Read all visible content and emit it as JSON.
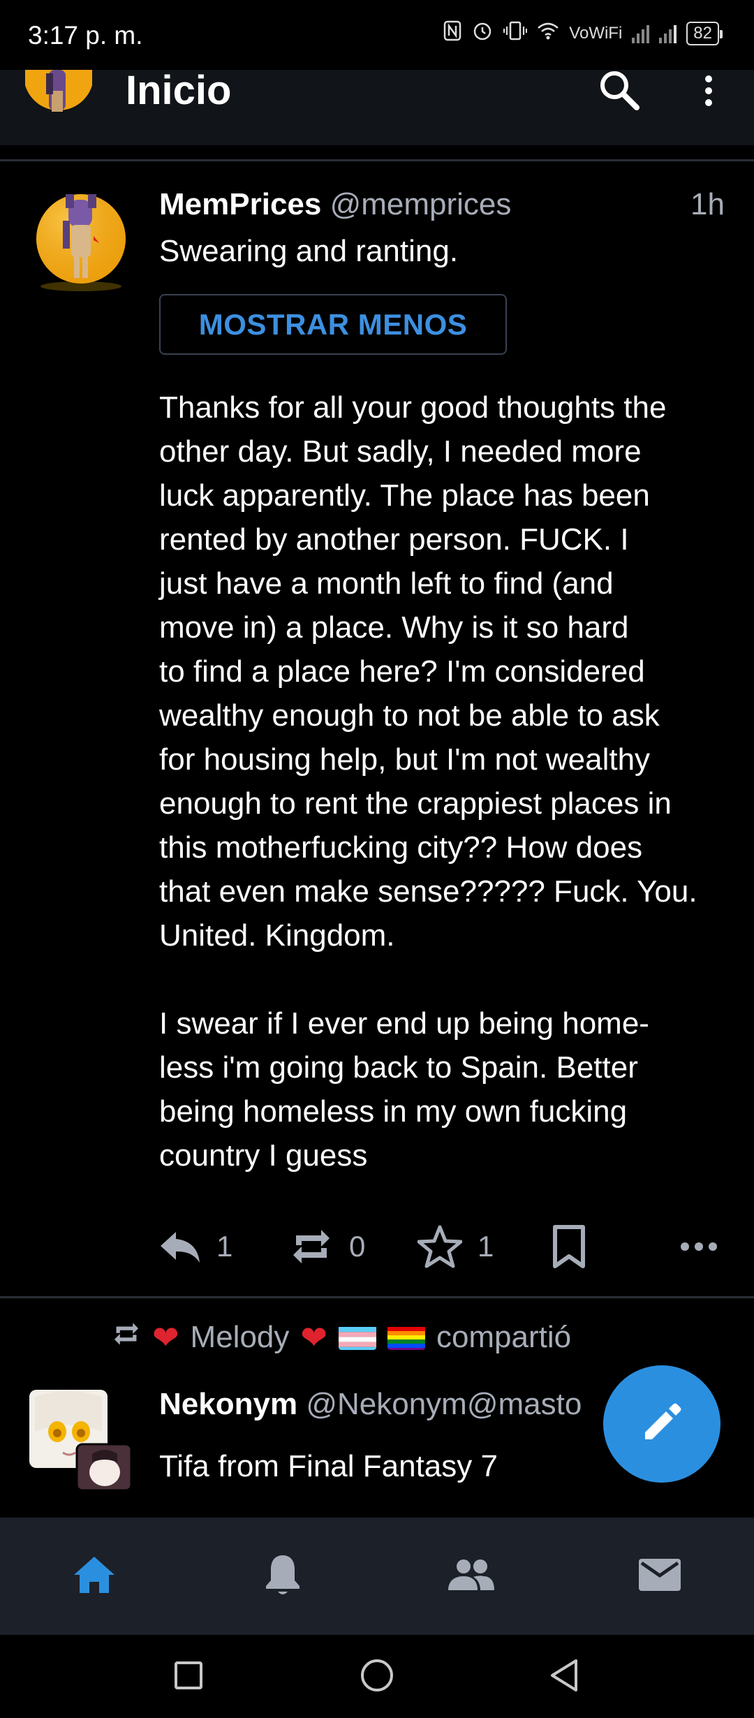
{
  "status_bar": {
    "time": "3:17 p. m.",
    "wifi_label": "VoWiFi",
    "battery": "82"
  },
  "app_bar": {
    "title": "Inicio",
    "icons": [
      "search-icon",
      "more-vert-icon"
    ]
  },
  "post": {
    "display_name": "MemPrices",
    "acct": "@memprices",
    "time": "1h",
    "spoiler_text": "Swearing and ranting.",
    "toggle_label": "MOSTRAR MENOS",
    "paragraphs": [
      "Thanks for all your good thoughts the\nother day. But sadly, I needed more\nluck apparently. The place has been\nrented by another person. FUCK. I\njust have a month left to find (and\nmove in) a place. Why is it so hard\nto find a place here? I'm considered\nwealthy enough to not be able to ask\nfor housing help, but I'm not wealthy\nenough to rent the crappiest places in\nthis motherfucking city?? How does\nthat even make sense????? Fuck. You.\nUnited. Kingdom.",
      "I swear if I ever end up being home-\nless i'm going back to Spain. Better\nbeing homeless in my own fucking\ncountry I guess"
    ],
    "actions": {
      "reply_count": "1",
      "boost_count": "0",
      "favourite_count": "1"
    }
  },
  "reblog": {
    "reblogger": "Melody",
    "label": "compartió"
  },
  "post2": {
    "display_name": "Nekonym",
    "acct": "@Nekonym@masto",
    "body": "Tifa from Final Fantasy 7"
  },
  "bottom_nav": [
    "home-icon",
    "notifications-icon",
    "people-icon",
    "mail-icon"
  ],
  "colors": {
    "accent": "#2b8fe0",
    "muted": "#a7adb8",
    "nav_background": "#1c2028"
  }
}
